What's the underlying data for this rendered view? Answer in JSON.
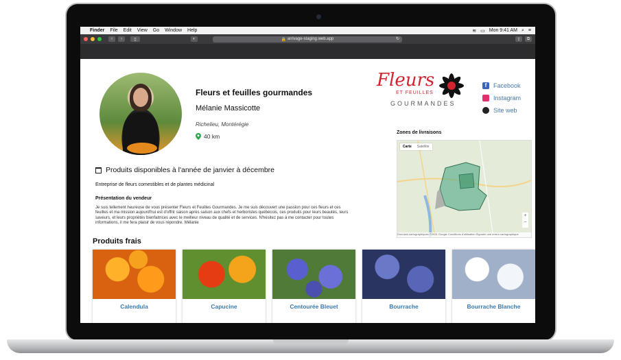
{
  "menubar": {
    "app": "Finder",
    "items": [
      "File",
      "Edit",
      "View",
      "Go",
      "Window",
      "Help"
    ],
    "clock": "Mon 9:41 AM"
  },
  "browser": {
    "url": "arrivage-staging.web.app"
  },
  "vendor": {
    "title": "Fleurs et feuilles gourmandes",
    "name": "Mélanie Massicotte",
    "location": "Richelieu, Montérégie",
    "distance": "40 km"
  },
  "availability": "Produits disponibles à l'année de janvier à décembre",
  "tagline": "Entreprise de fleurs comestibles et de plantes médicinal",
  "presentation": {
    "label": "Présentation du vendeur",
    "text": "Je suis tellement heureuse de vous présenter Fleurs et Feuilles Gourmandes. Je me suis découvert une passion pour ces fleurs et ces feuilles et ma mission aujourd'hui est d'offrir saison après saison aux chefs et herboristes québécois, ces produits pour leurs beautés, leurs saveurs, et leurs propriétés bienfaitrices avec le meilleur niveau de qualité et de services. N'hésitez pas à me contacter pour toutes informations, il me fera plaisir de vous répondre. Mélanie"
  },
  "logo": {
    "script": "Fleurs",
    "line1": "ET FEUILLES",
    "line2": "GOURMANDES"
  },
  "social": {
    "facebook": "Facebook",
    "instagram": "Instagram",
    "website": "Site web"
  },
  "zones": {
    "label": "Zones de livraisons",
    "tab_map": "Carte",
    "tab_sat": "Satellite",
    "footer": "Données cartographiques ©2021 Google  Conditions d'utilisation  Signaler une erreur cartographique"
  },
  "products_title": "Produits frais",
  "products": [
    {
      "name": "Calendula",
      "color": "#f08a1c"
    },
    {
      "name": "Capucine",
      "color": "#e8621c"
    },
    {
      "name": "Centourée Bleuet",
      "color": "#5a5fc0"
    },
    {
      "name": "Bourrache",
      "color": "#4c5aa0"
    },
    {
      "name": "Bourrache Blanche",
      "color": "#dfe6f0"
    }
  ]
}
